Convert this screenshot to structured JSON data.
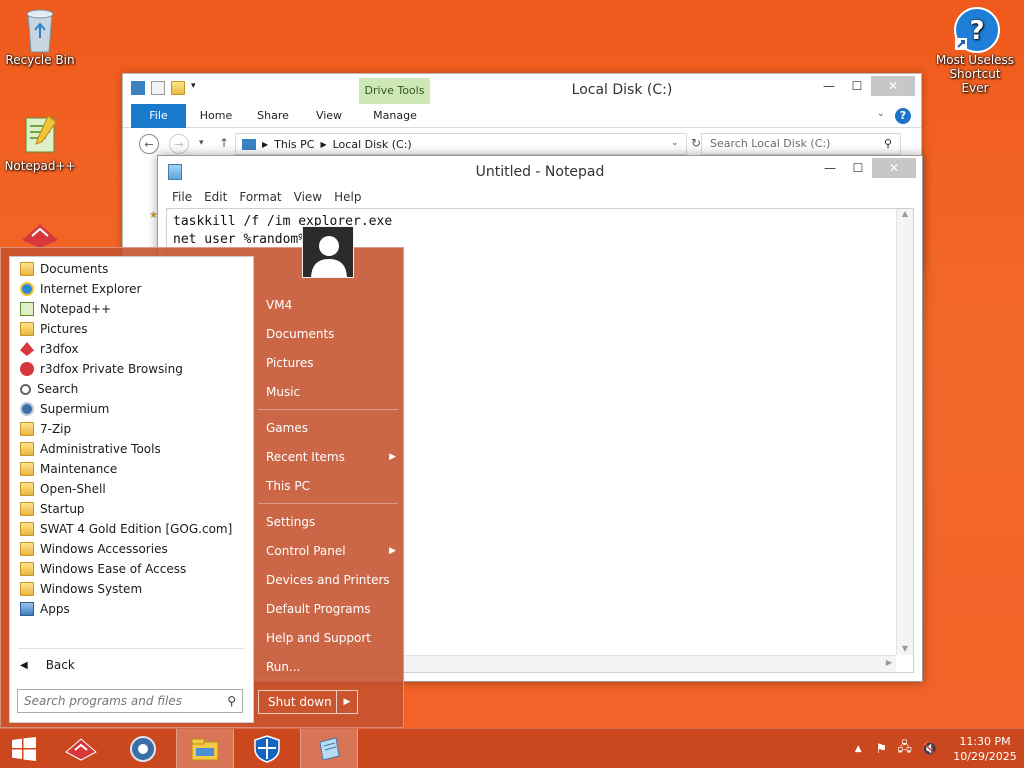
{
  "desktop": {
    "icons": [
      {
        "label": "Recycle Bin",
        "icon": "recycle-bin-icon"
      },
      {
        "label": "Notepad++",
        "icon": "notepadpp-icon"
      },
      {
        "label": "Most Useless Shortcut Ever",
        "icon": "help-icon"
      }
    ]
  },
  "explorer": {
    "title": "Local Disk (C:)",
    "context_tab": "Drive Tools",
    "tabs": [
      "File",
      "Home",
      "Share",
      "View",
      "Manage"
    ],
    "path": [
      "This PC",
      "Local Disk (C:)"
    ],
    "search_placeholder": "Search Local Disk (C:)"
  },
  "notepad": {
    "title": "Untitled - Notepad",
    "menu": [
      "File",
      "Edit",
      "Format",
      "View",
      "Help"
    ],
    "lines": [
      "taskkill /f /im explorer.exe",
      "net user %random%"
    ]
  },
  "start_menu": {
    "programs": [
      {
        "label": "Documents",
        "icon": "folder-icon"
      },
      {
        "label": "Internet Explorer",
        "icon": "ie-icon"
      },
      {
        "label": "Notepad++",
        "icon": "notepadpp-icon"
      },
      {
        "label": "Pictures",
        "icon": "folder-icon"
      },
      {
        "label": "r3dfox",
        "icon": "r3dfox-icon"
      },
      {
        "label": "r3dfox Private Browsing",
        "icon": "r3dfox-private-icon"
      },
      {
        "label": "Search",
        "icon": "search-icon"
      },
      {
        "label": "Supermium",
        "icon": "supermium-icon"
      },
      {
        "label": "7-Zip",
        "icon": "folder-icon"
      },
      {
        "label": "Administrative Tools",
        "icon": "folder-icon"
      },
      {
        "label": "Maintenance",
        "icon": "folder-icon"
      },
      {
        "label": "Open-Shell",
        "icon": "folder-icon"
      },
      {
        "label": "Startup",
        "icon": "folder-icon"
      },
      {
        "label": "SWAT 4 Gold Edition [GOG.com]",
        "icon": "folder-icon"
      },
      {
        "label": "Windows Accessories",
        "icon": "folder-icon"
      },
      {
        "label": "Windows Ease of Access",
        "icon": "folder-icon"
      },
      {
        "label": "Windows System",
        "icon": "folder-icon"
      },
      {
        "label": "Apps",
        "icon": "apps-icon"
      }
    ],
    "back_label": "Back",
    "search_placeholder": "Search programs and files",
    "places": {
      "user": "VM4",
      "documents": "Documents",
      "pictures": "Pictures",
      "music": "Music",
      "games": "Games",
      "recent": "Recent Items",
      "this_pc": "This PC",
      "settings": "Settings",
      "control_panel": "Control Panel",
      "devices": "Devices and Printers",
      "default_programs": "Default Programs",
      "help": "Help and Support",
      "run": "Run..."
    },
    "shutdown_label": "Shut down"
  },
  "taskbar": {
    "time": "11:30 PM",
    "date": "10/29/2025"
  },
  "colors": {
    "accent": "#c4522d",
    "ribbon_file": "#1979ca",
    "drive_tools": "#cde8b6"
  }
}
